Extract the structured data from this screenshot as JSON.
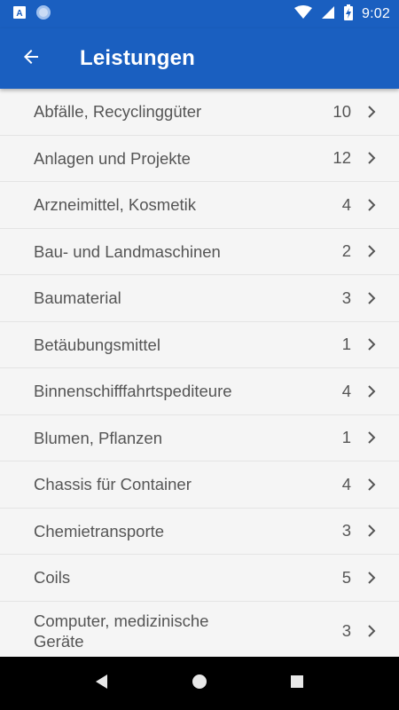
{
  "status_bar": {
    "time": "9:02"
  },
  "app_bar": {
    "title": "Leistungen"
  },
  "items": [
    {
      "label": "Abfälle, Recyclinggüter",
      "count": "10"
    },
    {
      "label": "Anlagen und Projekte",
      "count": "12"
    },
    {
      "label": "Arzneimittel, Kosmetik",
      "count": "4"
    },
    {
      "label": "Bau- und Landmaschinen",
      "count": "2"
    },
    {
      "label": "Baumaterial",
      "count": "3"
    },
    {
      "label": "Betäubungsmittel",
      "count": "1"
    },
    {
      "label": "Binnenschifffahrtspediteure",
      "count": "4"
    },
    {
      "label": "Blumen, Pflanzen",
      "count": "1"
    },
    {
      "label": "Chassis für Container",
      "count": "4"
    },
    {
      "label": "Chemietransporte",
      "count": "3"
    },
    {
      "label": "Coils",
      "count": "5"
    },
    {
      "label": "Computer, medizinische Geräte",
      "count": "3"
    }
  ],
  "colors": {
    "primary": "#1a5fc0",
    "background": "#f5f5f5",
    "text": "#555555",
    "divider": "#e4e4e4"
  },
  "icons": {
    "status_left": [
      "accessibility-icon",
      "sync-circle-icon"
    ],
    "status_right": [
      "wifi-icon",
      "signal-icon",
      "battery-charging-icon"
    ],
    "nav": [
      "back-triangle-icon",
      "home-circle-icon",
      "recents-square-icon"
    ]
  }
}
